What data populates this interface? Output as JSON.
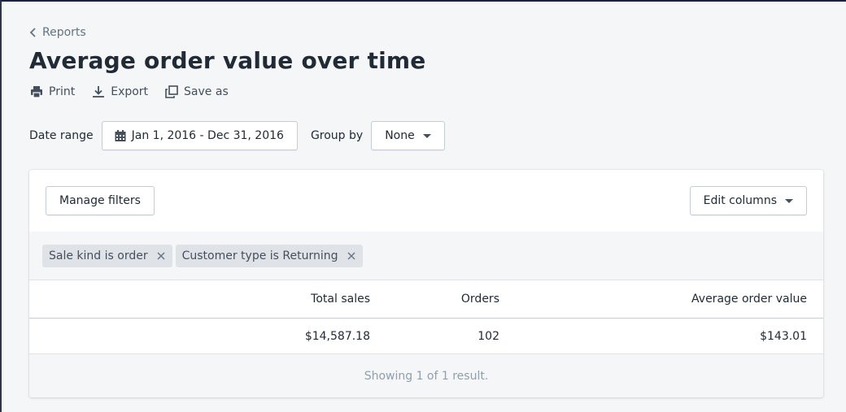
{
  "breadcrumb": {
    "label": "Reports"
  },
  "page": {
    "title": "Average order value over time"
  },
  "actions": [
    {
      "label": "Print",
      "icon": "printer-icon"
    },
    {
      "label": "Export",
      "icon": "download-icon"
    },
    {
      "label": "Save as",
      "icon": "duplicate-icon"
    }
  ],
  "controls": {
    "date_range_label": "Date range",
    "date_range_value": "Jan 1, 2016 - Dec 31, 2016",
    "group_by_label": "Group by",
    "group_by_value": "None"
  },
  "card": {
    "manage_filters": "Manage filters",
    "edit_columns": "Edit columns",
    "filters": [
      {
        "label": "Sale kind is order"
      },
      {
        "label": "Customer type is Returning"
      }
    ],
    "table": {
      "headers": [
        "Total sales",
        "Orders",
        "Average order value"
      ],
      "rows": [
        [
          "$14,587.18",
          "102",
          "$143.01"
        ]
      ]
    },
    "footer": "Showing 1 of 1 result."
  },
  "colors": {
    "background": "#f4f6f8",
    "text": "#212b36",
    "muted": "#919eab",
    "tag": "#dfe3e8"
  }
}
